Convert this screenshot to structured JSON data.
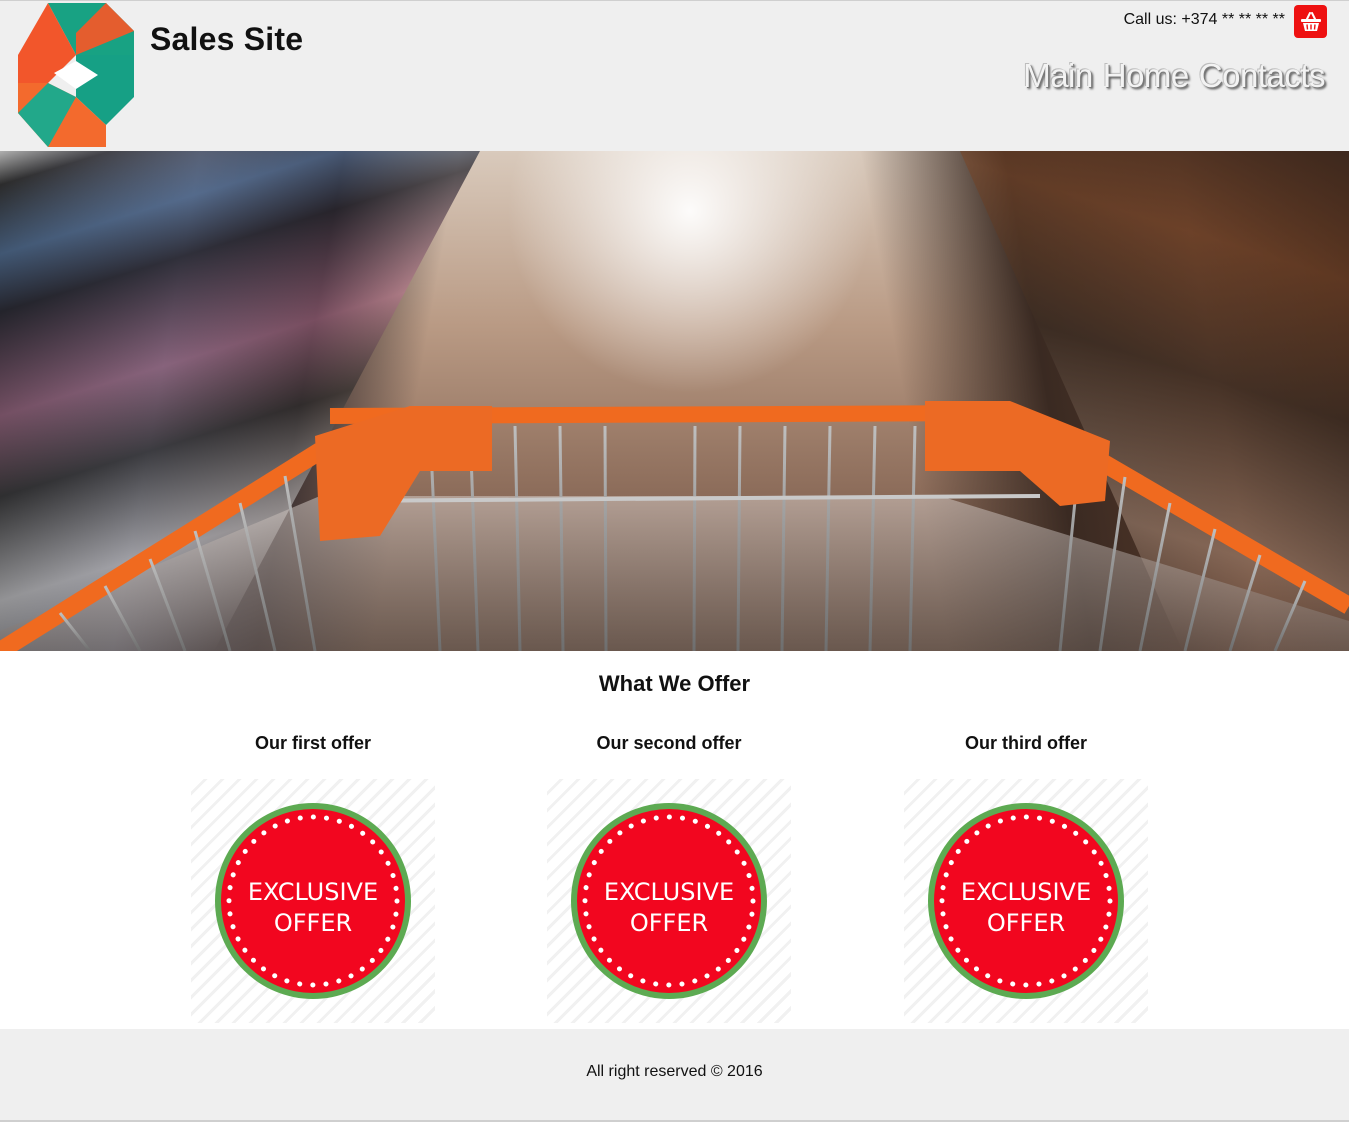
{
  "header": {
    "site_title": "Sales Site",
    "call_label": "Call us: +374 ** ** ** **",
    "cart_icon": "shopping-basket-icon",
    "nav": [
      "Main",
      "Home",
      "Contacts"
    ]
  },
  "hero": {
    "image": "shopping-cart-hero"
  },
  "offers": {
    "title": "What We Offer",
    "items": [
      {
        "title": "Our first offer",
        "badge_line1": "EXCLUSIVE",
        "badge_line2": "OFFER"
      },
      {
        "title": "Our second offer",
        "badge_line1": "EXCLUSIVE",
        "badge_line2": "OFFER"
      },
      {
        "title": "Our third offer",
        "badge_line1": "EXCLUSIVE",
        "badge_line2": "OFFER"
      }
    ]
  },
  "footer": {
    "text": "All right reserved © 2016"
  },
  "colors": {
    "header_bg": "#efefef",
    "badge_red": "#f2061f",
    "badge_ring": "#5daa52",
    "cart_orange": "#f06a1f",
    "cart_button": "#ee1111"
  }
}
